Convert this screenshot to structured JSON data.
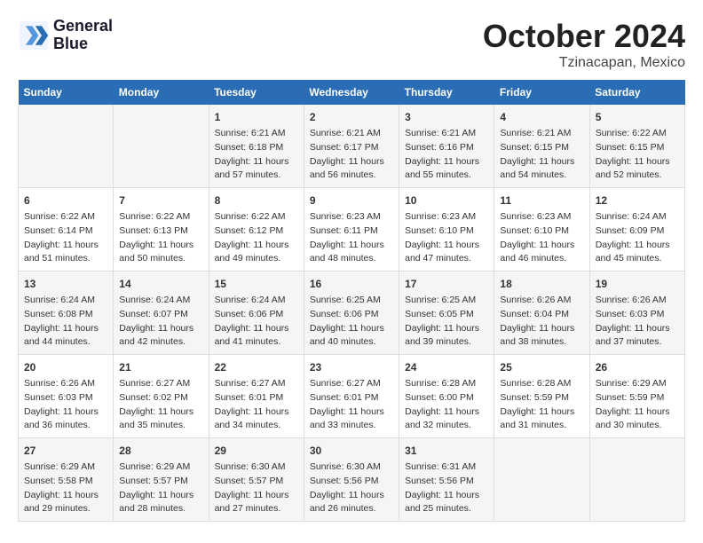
{
  "header": {
    "logo_line1": "General",
    "logo_line2": "Blue",
    "title": "October 2024",
    "subtitle": "Tzinacapan, Mexico"
  },
  "columns": [
    "Sunday",
    "Monday",
    "Tuesday",
    "Wednesday",
    "Thursday",
    "Friday",
    "Saturday"
  ],
  "weeks": [
    [
      {
        "day": "",
        "info": ""
      },
      {
        "day": "",
        "info": ""
      },
      {
        "day": "1",
        "info": "Sunrise: 6:21 AM\nSunset: 6:18 PM\nDaylight: 11 hours and 57 minutes."
      },
      {
        "day": "2",
        "info": "Sunrise: 6:21 AM\nSunset: 6:17 PM\nDaylight: 11 hours and 56 minutes."
      },
      {
        "day": "3",
        "info": "Sunrise: 6:21 AM\nSunset: 6:16 PM\nDaylight: 11 hours and 55 minutes."
      },
      {
        "day": "4",
        "info": "Sunrise: 6:21 AM\nSunset: 6:15 PM\nDaylight: 11 hours and 54 minutes."
      },
      {
        "day": "5",
        "info": "Sunrise: 6:22 AM\nSunset: 6:15 PM\nDaylight: 11 hours and 52 minutes."
      }
    ],
    [
      {
        "day": "6",
        "info": "Sunrise: 6:22 AM\nSunset: 6:14 PM\nDaylight: 11 hours and 51 minutes."
      },
      {
        "day": "7",
        "info": "Sunrise: 6:22 AM\nSunset: 6:13 PM\nDaylight: 11 hours and 50 minutes."
      },
      {
        "day": "8",
        "info": "Sunrise: 6:22 AM\nSunset: 6:12 PM\nDaylight: 11 hours and 49 minutes."
      },
      {
        "day": "9",
        "info": "Sunrise: 6:23 AM\nSunset: 6:11 PM\nDaylight: 11 hours and 48 minutes."
      },
      {
        "day": "10",
        "info": "Sunrise: 6:23 AM\nSunset: 6:10 PM\nDaylight: 11 hours and 47 minutes."
      },
      {
        "day": "11",
        "info": "Sunrise: 6:23 AM\nSunset: 6:10 PM\nDaylight: 11 hours and 46 minutes."
      },
      {
        "day": "12",
        "info": "Sunrise: 6:24 AM\nSunset: 6:09 PM\nDaylight: 11 hours and 45 minutes."
      }
    ],
    [
      {
        "day": "13",
        "info": "Sunrise: 6:24 AM\nSunset: 6:08 PM\nDaylight: 11 hours and 44 minutes."
      },
      {
        "day": "14",
        "info": "Sunrise: 6:24 AM\nSunset: 6:07 PM\nDaylight: 11 hours and 42 minutes."
      },
      {
        "day": "15",
        "info": "Sunrise: 6:24 AM\nSunset: 6:06 PM\nDaylight: 11 hours and 41 minutes."
      },
      {
        "day": "16",
        "info": "Sunrise: 6:25 AM\nSunset: 6:06 PM\nDaylight: 11 hours and 40 minutes."
      },
      {
        "day": "17",
        "info": "Sunrise: 6:25 AM\nSunset: 6:05 PM\nDaylight: 11 hours and 39 minutes."
      },
      {
        "day": "18",
        "info": "Sunrise: 6:26 AM\nSunset: 6:04 PM\nDaylight: 11 hours and 38 minutes."
      },
      {
        "day": "19",
        "info": "Sunrise: 6:26 AM\nSunset: 6:03 PM\nDaylight: 11 hours and 37 minutes."
      }
    ],
    [
      {
        "day": "20",
        "info": "Sunrise: 6:26 AM\nSunset: 6:03 PM\nDaylight: 11 hours and 36 minutes."
      },
      {
        "day": "21",
        "info": "Sunrise: 6:27 AM\nSunset: 6:02 PM\nDaylight: 11 hours and 35 minutes."
      },
      {
        "day": "22",
        "info": "Sunrise: 6:27 AM\nSunset: 6:01 PM\nDaylight: 11 hours and 34 minutes."
      },
      {
        "day": "23",
        "info": "Sunrise: 6:27 AM\nSunset: 6:01 PM\nDaylight: 11 hours and 33 minutes."
      },
      {
        "day": "24",
        "info": "Sunrise: 6:28 AM\nSunset: 6:00 PM\nDaylight: 11 hours and 32 minutes."
      },
      {
        "day": "25",
        "info": "Sunrise: 6:28 AM\nSunset: 5:59 PM\nDaylight: 11 hours and 31 minutes."
      },
      {
        "day": "26",
        "info": "Sunrise: 6:29 AM\nSunset: 5:59 PM\nDaylight: 11 hours and 30 minutes."
      }
    ],
    [
      {
        "day": "27",
        "info": "Sunrise: 6:29 AM\nSunset: 5:58 PM\nDaylight: 11 hours and 29 minutes."
      },
      {
        "day": "28",
        "info": "Sunrise: 6:29 AM\nSunset: 5:57 PM\nDaylight: 11 hours and 28 minutes."
      },
      {
        "day": "29",
        "info": "Sunrise: 6:30 AM\nSunset: 5:57 PM\nDaylight: 11 hours and 27 minutes."
      },
      {
        "day": "30",
        "info": "Sunrise: 6:30 AM\nSunset: 5:56 PM\nDaylight: 11 hours and 26 minutes."
      },
      {
        "day": "31",
        "info": "Sunrise: 6:31 AM\nSunset: 5:56 PM\nDaylight: 11 hours and 25 minutes."
      },
      {
        "day": "",
        "info": ""
      },
      {
        "day": "",
        "info": ""
      }
    ]
  ]
}
